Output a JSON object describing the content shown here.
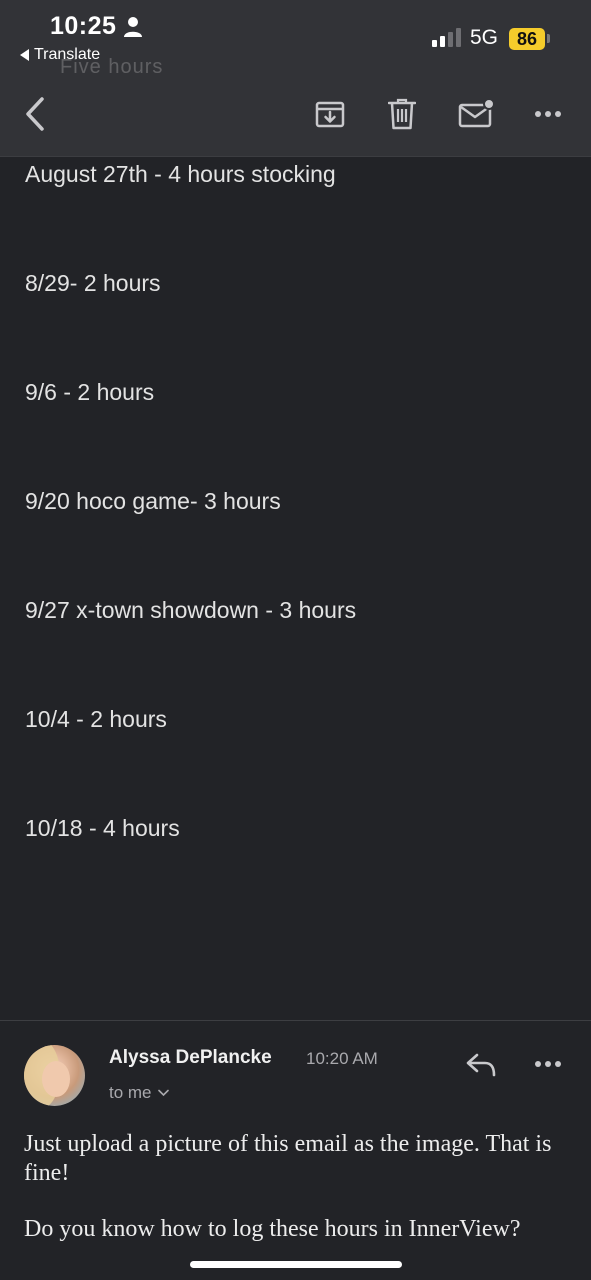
{
  "status_bar": {
    "time": "10:25",
    "back_app_label": "Translate",
    "network": "5G",
    "battery": "86"
  },
  "header": {
    "ghost_text": "Five hours"
  },
  "toolbar": {
    "icons": [
      "chevron-left-icon",
      "archive-icon",
      "trash-icon",
      "mark-unread-icon",
      "more-icon"
    ]
  },
  "email_body": {
    "lines": [
      "August 27th - 4 hours stocking",
      "8/29- 2 hours",
      "9/6 - 2 hours",
      "9/20 hoco game- 3 hours",
      "9/27 x-town showdown - 3 hours",
      "10/4 - 2 hours",
      "10/18 - 4 hours"
    ]
  },
  "reply": {
    "sender": "Alyssa DePlancke",
    "time": "10:20 AM",
    "recipient": "to me",
    "paragraphs": [
      "Just upload a picture of this email as the image. That is fine!",
      "Do you know how to log these hours in InnerView?"
    ]
  },
  "colors": {
    "background": "#222327",
    "header": "#323337",
    "battery": "#f5cc2b"
  }
}
